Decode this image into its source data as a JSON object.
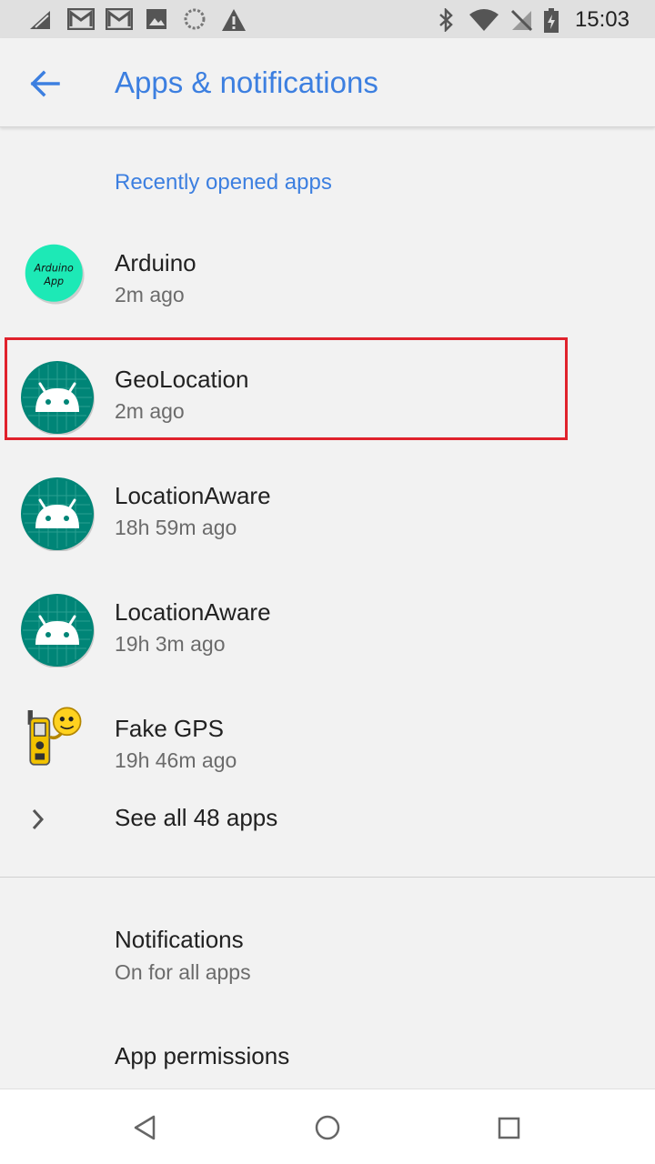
{
  "status_bar": {
    "time": "15:03",
    "left_icons": [
      "signal-outline-icon",
      "gmail-icon",
      "gmail-icon",
      "image-icon",
      "sync-icon",
      "warning-icon"
    ],
    "right_icons": [
      "bluetooth-icon",
      "wifi-icon",
      "no-signal-icon",
      "battery-charging-icon"
    ]
  },
  "app_bar": {
    "title": "Apps & notifications",
    "back_icon": "arrow-back-icon",
    "accent_color": "#3c7fe0"
  },
  "recent_apps": {
    "header": "Recently opened apps",
    "items": [
      {
        "name": "Arduino",
        "time": "2m ago",
        "icon": "arduino-app-icon",
        "icon_text_line1": "Arduino",
        "icon_text_line2": "App"
      },
      {
        "name": "GeoLocation",
        "time": "2m ago",
        "icon": "android-robot-icon",
        "highlighted": true
      },
      {
        "name": "LocationAware",
        "time": "18h 59m ago",
        "icon": "android-robot-icon"
      },
      {
        "name": "LocationAware",
        "time": "19h 3m ago",
        "icon": "android-robot-icon"
      },
      {
        "name": "Fake GPS",
        "time": "19h 46m ago",
        "icon": "fake-gps-icon"
      }
    ],
    "see_all": "See all 48 apps"
  },
  "settings": [
    {
      "title": "Notifications",
      "subtitle": "On for all apps"
    },
    {
      "title": "App permissions",
      "subtitle": ""
    }
  ],
  "highlight_color": "#e0222c",
  "nav_bar": {
    "icons": [
      "back-triangle-icon",
      "home-circle-icon",
      "recents-square-icon"
    ]
  }
}
